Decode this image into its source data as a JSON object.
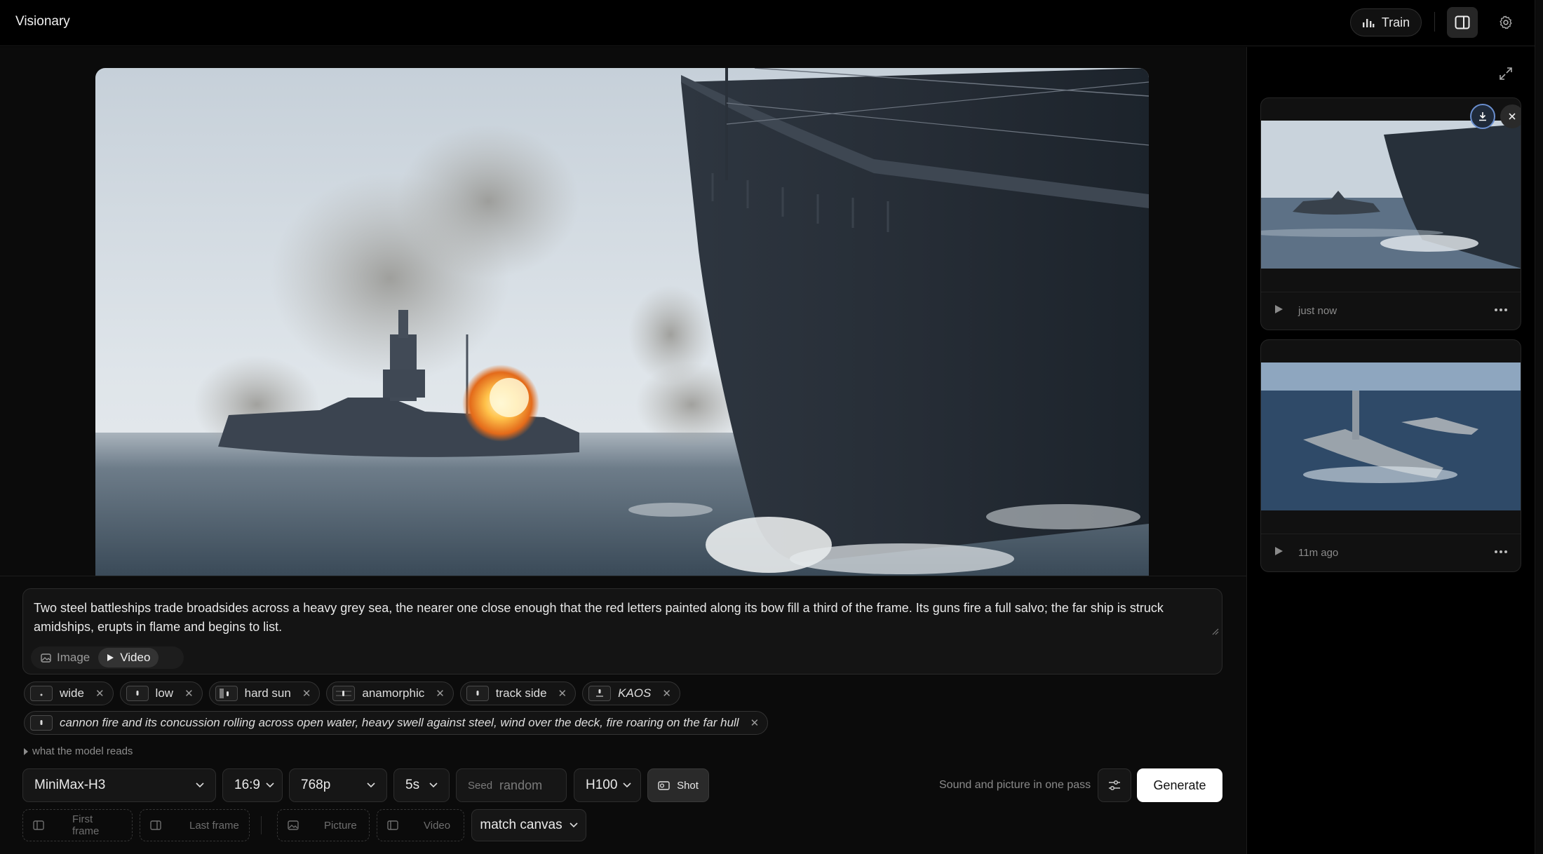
{
  "app": {
    "title": "Visionary"
  },
  "topbar": {
    "train_label": "Train"
  },
  "prompt": {
    "text": "Two steel battleships trade broadsides across a heavy grey sea, the nearer one close enough that the red letters painted along its bow fill a third of the frame. Its guns fire a full salvo; the far ship is struck amidships, erupts in flame and begins to list.",
    "modes": [
      {
        "label": "Image",
        "active": false
      },
      {
        "label": "Video",
        "active": true
      }
    ]
  },
  "chips": [
    {
      "label": "wide"
    },
    {
      "label": "low"
    },
    {
      "label": "hard sun"
    },
    {
      "label": "anamorphic"
    },
    {
      "label": "track side"
    },
    {
      "label": "KAOS"
    }
  ],
  "sound_chip": {
    "label": "cannon fire and its concussion rolling across open water, heavy swell against steel, wind over the deck, fire roaring on the far hull"
  },
  "reads_toggle": "what the model reads",
  "controls": {
    "model": "MiniMax-H3",
    "aspect": "16:9",
    "resolution": "768p",
    "duration": "5s",
    "seed_label": "Seed",
    "seed_value": "random",
    "gpu": "H100",
    "shot_label": "Shot",
    "sound_note": "Sound and picture in one pass",
    "generate_label": "Generate"
  },
  "slots": {
    "first_frame": "First frame",
    "last_frame": "Last frame",
    "picture": "Picture",
    "video": "Video",
    "match_canvas": "match canvas"
  },
  "gallery": [
    {
      "time": "just now"
    },
    {
      "time": "11m ago"
    }
  ],
  "colors": {
    "background": "#000000",
    "panel": "#0b0b0b",
    "accent_download": "#6a8fd0",
    "generate_bg": "#ffffff"
  }
}
